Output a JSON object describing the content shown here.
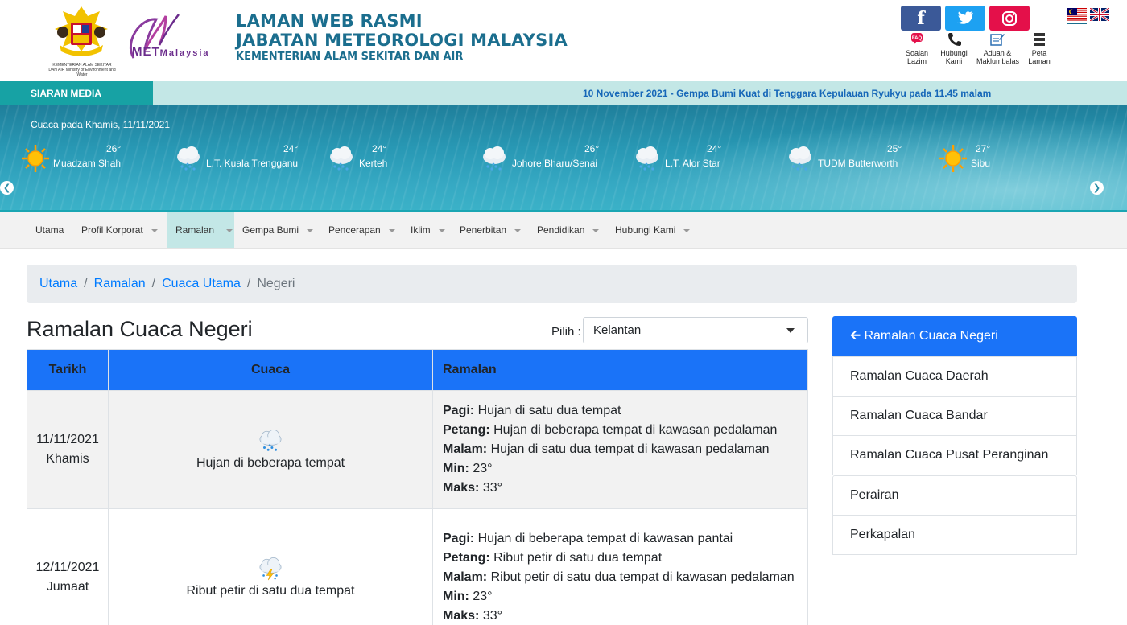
{
  "header": {
    "crest_caption": "KEMENTERIAN ALAM SEKITAR DAN AIR Ministry of Environment and Water",
    "met_logo_text": "MET",
    "met_logo_text2": "Malaysia",
    "title_line1": "LAMAN WEB RASMI",
    "title_line2": "JABATAN METEOROLOGI MALAYSIA",
    "title_line3": "KEMENTERIAN ALAM SEKITAR DAN AIR",
    "social": {
      "facebook": "f",
      "twitter": "twitter-icon",
      "instagram": "instagram-icon"
    },
    "quick_links": [
      {
        "label1": "Soalan",
        "label2": "Lazim",
        "icon": "faq-icon"
      },
      {
        "label1": "Hubungi",
        "label2": "Kami",
        "icon": "phone-icon"
      },
      {
        "label1": "Aduan &",
        "label2": "Maklumbalas",
        "icon": "feedback-icon"
      },
      {
        "label1": "Peta",
        "label2": "Laman",
        "icon": "sitemap-icon"
      }
    ],
    "languages": [
      "malaysia-flag-icon",
      "uk-flag-icon"
    ]
  },
  "media": {
    "label": "SIARAN MEDIA",
    "ticker": "10 November 2021 - Gempa Bumi Kuat di Tenggara Kepulauan Ryukyu pada 11.45 malam"
  },
  "banner": {
    "date": "Cuaca pada Khamis, 11/11/2021",
    "stations": [
      {
        "name": "Muadzam Shah",
        "temp": "26°",
        "icon": "sun-icon"
      },
      {
        "name": "L.T. Kuala Trengganu",
        "temp": "24°",
        "icon": "rain-cloud-icon"
      },
      {
        "name": "Kerteh",
        "temp": "24°",
        "icon": "rain-cloud-icon"
      },
      {
        "name": "Johore Bharu/Senai",
        "temp": "26°",
        "icon": "rain-cloud-icon"
      },
      {
        "name": "L.T. Alor Star",
        "temp": "24°",
        "icon": "rain-cloud-icon"
      },
      {
        "name": "TUDM Butterworth",
        "temp": "25°",
        "icon": "rain-cloud-icon"
      },
      {
        "name": "Sibu",
        "temp": "27°",
        "icon": "sun-icon"
      }
    ]
  },
  "nav": {
    "items": [
      {
        "label": "Utama",
        "dropdown": false
      },
      {
        "label": "Profil Korporat",
        "dropdown": true
      },
      {
        "label": "Ramalan",
        "dropdown": true,
        "active": true
      },
      {
        "label": "Gempa Bumi",
        "dropdown": true
      },
      {
        "label": "Pencerapan",
        "dropdown": true
      },
      {
        "label": "Iklim",
        "dropdown": true
      },
      {
        "label": "Penerbitan",
        "dropdown": true
      },
      {
        "label": "Pendidikan",
        "dropdown": true
      },
      {
        "label": "Hubungi Kami",
        "dropdown": true
      }
    ]
  },
  "breadcrumb": {
    "items": [
      "Utama",
      "Ramalan",
      "Cuaca Utama"
    ],
    "current": "Negeri",
    "separator": "/"
  },
  "main": {
    "title": "Ramalan Cuaca Negeri",
    "select_label": "Pilih :",
    "select_value": "Kelantan",
    "table": {
      "headers": [
        "Tarikh",
        "Cuaca",
        "Ramalan"
      ],
      "rows": [
        {
          "date": "11/11/2021",
          "day": "Khamis",
          "icon": "rain-cloud-icon",
          "weather": "Hujan di beberapa tempat",
          "pagi_label": "Pagi:",
          "pagi": "Hujan di satu dua tempat",
          "petang_label": "Petang:",
          "petang": "Hujan di beberapa tempat di kawasan pedalaman",
          "malam_label": "Malam:",
          "malam": "Hujan di satu dua tempat di kawasan pedalaman",
          "min_label": "Min:",
          "min": "23°",
          "maks_label": "Maks:",
          "maks": "33°"
        },
        {
          "date": "12/11/2021",
          "day": "Jumaat",
          "icon": "thunderstorm-icon",
          "weather": "Ribut petir di satu dua tempat",
          "pagi_label": "Pagi:",
          "pagi": "Hujan di beberapa tempat di kawasan pantai",
          "petang_label": "Petang:",
          "petang": "Ribut petir di satu dua tempat",
          "malam_label": "Malam:",
          "malam": "Ribut petir di satu dua tempat di kawasan pedalaman",
          "min_label": "Min:",
          "min": "23°",
          "maks_label": "Maks:",
          "maks": "33°"
        }
      ]
    }
  },
  "sidebar": {
    "head": "Ramalan Cuaca Negeri",
    "items": [
      "Ramalan Cuaca Daerah",
      "Ramalan Cuaca Bandar",
      "Ramalan Cuaca Pusat Peranginan",
      "Perairan",
      "Perkapalan"
    ]
  },
  "colors": {
    "primary": "#1a73f8",
    "teal": "#17a2a4",
    "teal_light": "#c3e7e6",
    "title_blue": "#1b6e8e",
    "link": "#007bff"
  }
}
